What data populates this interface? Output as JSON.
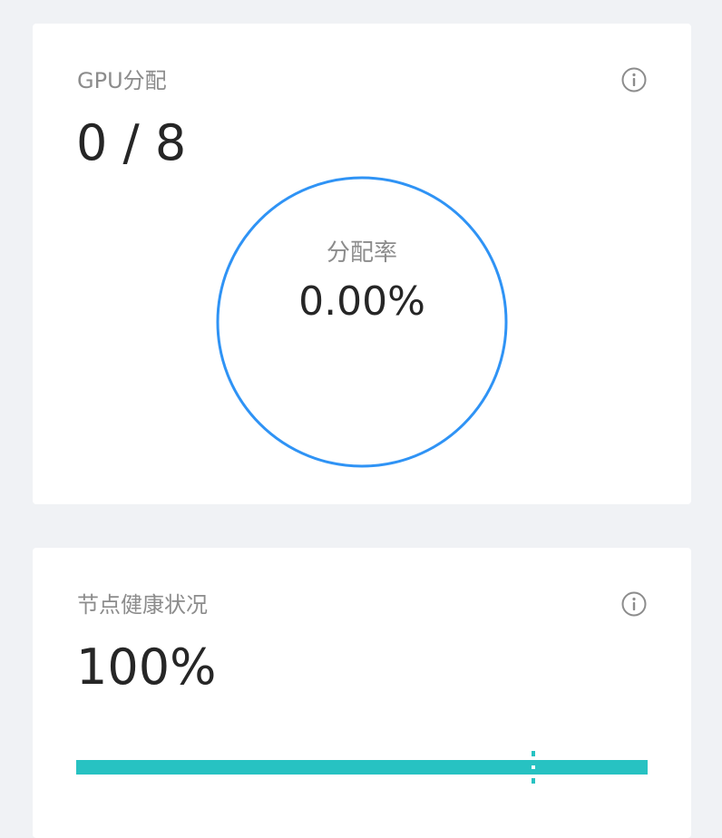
{
  "gpu_card": {
    "title": "GPU分配",
    "value": "0 / 8",
    "ring": {
      "label": "分配率",
      "value": "0.00%",
      "percent": 0,
      "color": "#2f93f5"
    },
    "info_icon": "info-circle-icon"
  },
  "health_card": {
    "title": "节点健康状况",
    "value": "100%",
    "progress": {
      "percent": 100,
      "marker_percent": 80,
      "color": "#27c2c2"
    },
    "info_icon": "info-circle-icon"
  }
}
